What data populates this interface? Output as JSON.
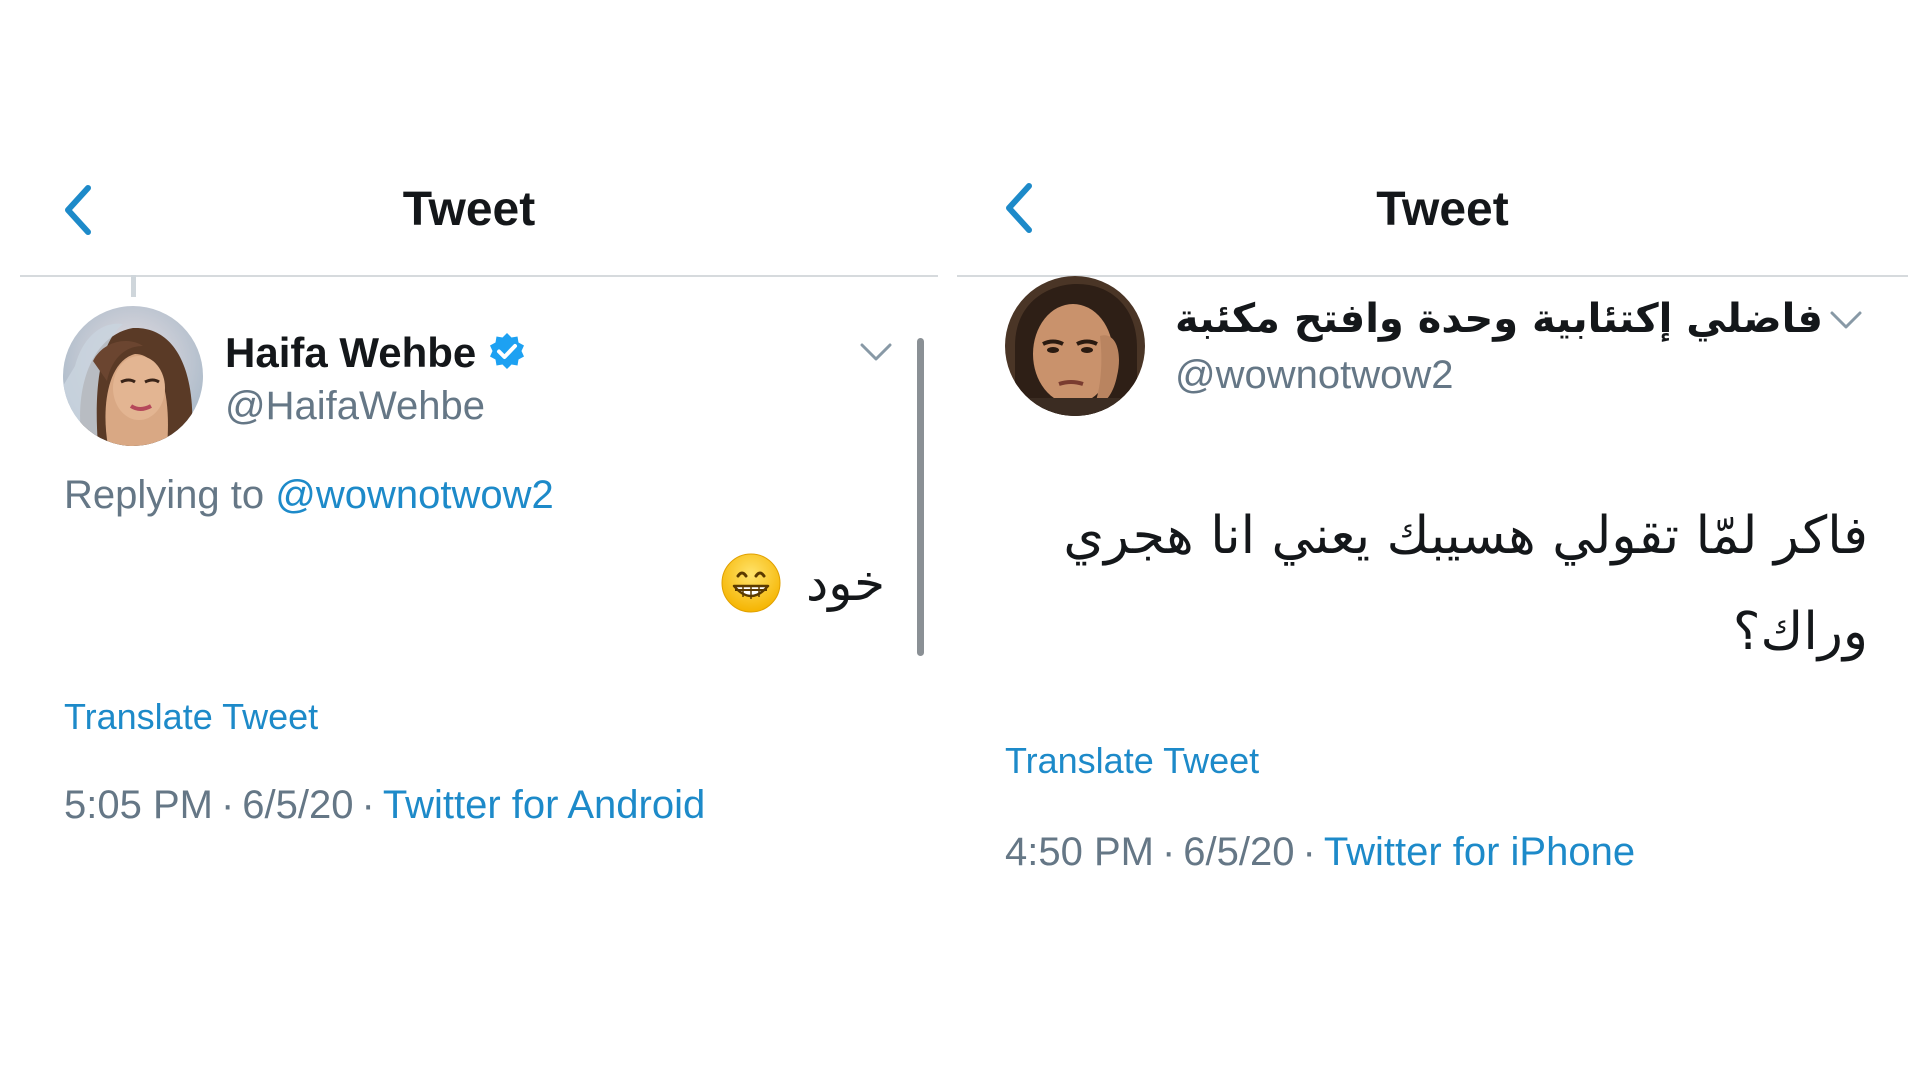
{
  "left_panel": {
    "header": {
      "title": "Tweet"
    },
    "tweet": {
      "author_name": "Haifa Wehbe",
      "author_handle": "@HaifaWehbe",
      "verified": true,
      "replying_prefix": "Replying to",
      "replying_to": "@wownotwow2",
      "text": "خود",
      "emoji": "grinning-face-with-smiling-eyes",
      "translate_label": "Translate Tweet",
      "time": "5:05 PM",
      "date": "6/5/20",
      "separator": "·",
      "source": "Twitter for Android"
    }
  },
  "right_panel": {
    "header": {
      "title": "Tweet"
    },
    "tweet": {
      "author_name": "فاضلي إكتئابية وحدة وافتح مكئبة",
      "author_handle": "@wownotwow2",
      "text": "فاكر لمّا تقولي هسيبك يعني انا هجري وراك؟",
      "translate_label": "Translate Tweet",
      "time": "4:50 PM",
      "date": "6/5/20",
      "separator": "·",
      "source": "Twitter for iPhone"
    }
  },
  "colors": {
    "accent": "#1d8ac9",
    "verified": "#1da1f2",
    "muted_text": "#657786",
    "primary_text": "#14171a",
    "divider": "#d6dadd"
  },
  "icons": {
    "back": "chevron-left-icon",
    "menu": "chevron-down-icon",
    "verified": "verified-badge-icon"
  }
}
